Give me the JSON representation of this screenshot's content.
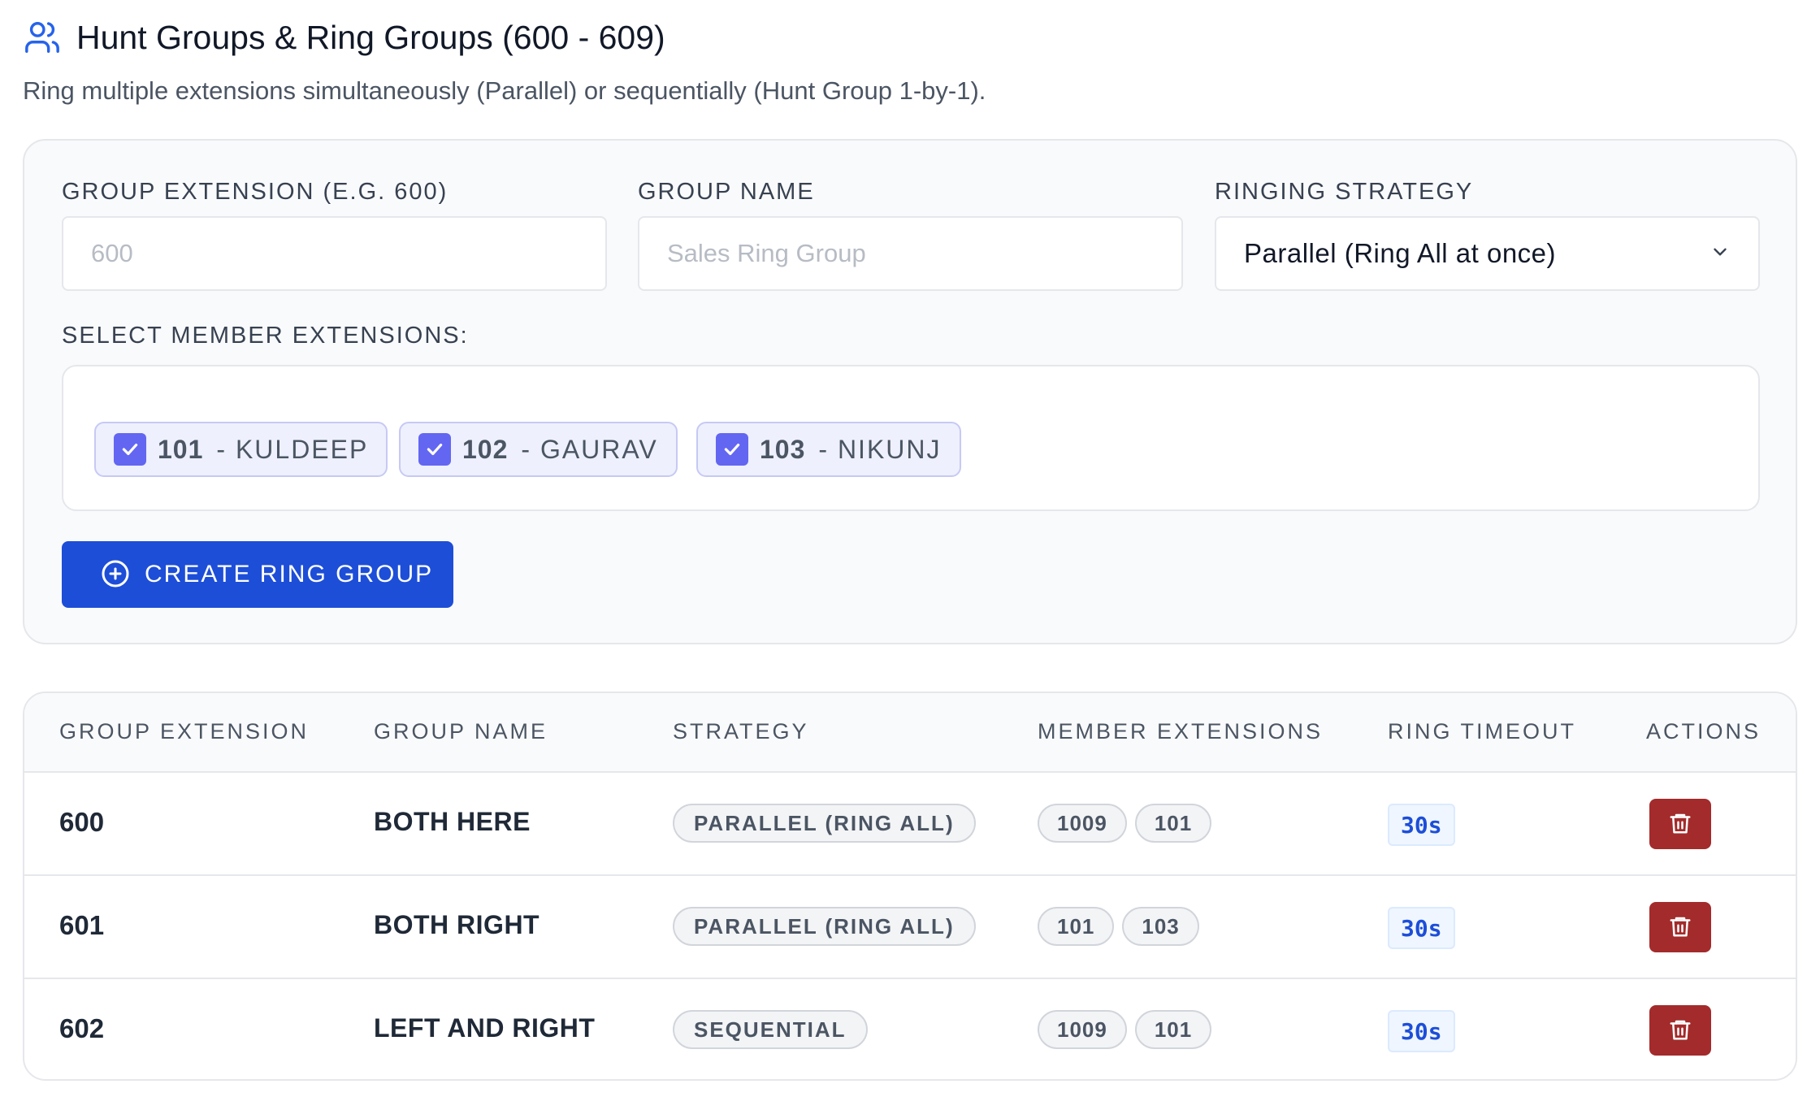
{
  "header": {
    "title": "Hunt Groups & Ring Groups (600 - 609)",
    "subtitle": "Ring multiple extensions simultaneously (Parallel) or sequentially (Hunt Group 1-by-1).",
    "icon": "users-icon"
  },
  "form": {
    "extension_label": "GROUP EXTENSION (E.G. 600)",
    "extension_placeholder": "600",
    "name_label": "GROUP NAME",
    "name_placeholder": "Sales Ring Group",
    "strategy_label": "RINGING STRATEGY",
    "strategy_value": "Parallel (Ring All at once)",
    "members_label": "SELECT MEMBER EXTENSIONS:",
    "members": [
      {
        "ext": "101",
        "name": "- KULDEEP",
        "checked": true
      },
      {
        "ext": "102",
        "name": "- GAURAV",
        "checked": true
      },
      {
        "ext": "103",
        "name": "- NIKUNJ",
        "checked": true
      }
    ],
    "create_label": "CREATE RING GROUP"
  },
  "table": {
    "headers": [
      "GROUP EXTENSION",
      "GROUP NAME",
      "STRATEGY",
      "MEMBER EXTENSIONS",
      "RING TIMEOUT",
      "ACTIONS"
    ],
    "rows": [
      {
        "ext": "600",
        "name": "BOTH HERE",
        "strategy": "PARALLEL (RING ALL)",
        "members": [
          "1009",
          "101"
        ],
        "timeout": "30s"
      },
      {
        "ext": "601",
        "name": "BOTH RIGHT",
        "strategy": "PARALLEL (RING ALL)",
        "members": [
          "101",
          "103"
        ],
        "timeout": "30s"
      },
      {
        "ext": "602",
        "name": "LEFT AND RIGHT",
        "strategy": "SEQUENTIAL",
        "members": [
          "1009",
          "101"
        ],
        "timeout": "30s"
      }
    ]
  },
  "colors": {
    "primary": "#1d4ed8",
    "checkbox": "#6366f1",
    "danger": "#a32b2b",
    "title_icon": "#2563eb"
  }
}
